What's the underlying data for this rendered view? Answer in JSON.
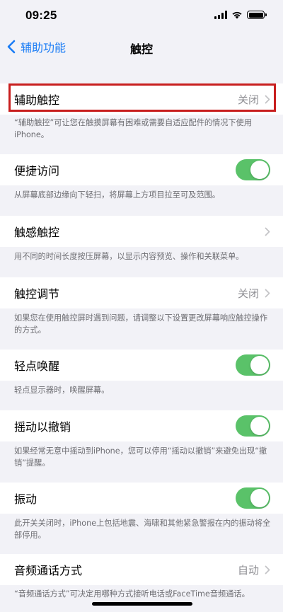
{
  "status_bar": {
    "time": "09:25"
  },
  "nav": {
    "back_label": "辅助功能",
    "title": "触控"
  },
  "sections": [
    {
      "label": "辅助触控",
      "value": "关闭",
      "control": "chevron",
      "footer": "“辅助触控”可让您在触摸屏幕有困难或需要自适应配件的情况下使用iPhone。"
    },
    {
      "label": "便捷访问",
      "control": "toggle",
      "toggle_on": true,
      "footer": "从屏幕底部边缘向下轻扫，将屏幕上方项目拉至可及范围。"
    },
    {
      "label": "触感触控",
      "value": "",
      "control": "chevron",
      "footer": "用不同的时间长度按压屏幕，以显示内容预览、操作和关联菜单。"
    },
    {
      "label": "触控调节",
      "value": "关闭",
      "control": "chevron",
      "footer": "如果您在使用触控屏时遇到问题，请调整以下设置更改屏幕响应触控操作的方式。"
    },
    {
      "label": "轻点唤醒",
      "control": "toggle",
      "toggle_on": true,
      "footer": "轻点显示器时，唤醒屏幕。"
    },
    {
      "label": "摇动以撤销",
      "control": "toggle",
      "toggle_on": true,
      "footer": "如果经常无意中摇动到iPhone，您可以停用“摇动以撤销”来避免出现“撤销”提醒。"
    },
    {
      "label": "振动",
      "control": "toggle",
      "toggle_on": true,
      "footer": "此开关关闭时，iPhone上包括地震、海啸和其他紧急警报在内的振动将全部停用。"
    },
    {
      "label": "音频通话方式",
      "value": "自动",
      "control": "chevron",
      "footer": "“音频通话方式”可决定用哪种方式接听电话或FaceTime音频通话。"
    }
  ],
  "colors": {
    "accent": "#1a7cf5",
    "toggle_on": "#5ac269",
    "highlight": "#c81e1e"
  }
}
